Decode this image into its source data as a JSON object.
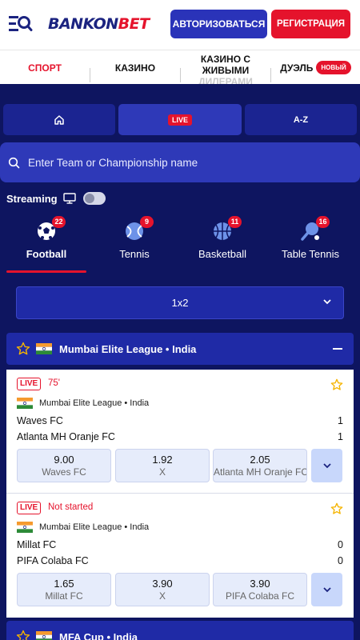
{
  "brand": {
    "logo_part1": "BANKON",
    "logo_part2": "BET"
  },
  "header": {
    "login_label": "АВТОРИЗОВАТЬСЯ",
    "register_label": "РЕГИСТРАЦИЯ"
  },
  "nav": {
    "items": [
      {
        "label": "СПОРТ"
      },
      {
        "label": "КАЗИНО"
      },
      {
        "label_line1": "КАЗИНО С",
        "label_line2": "ЖИВЫМИ",
        "label_line3": "ДИЛЕРАМИ"
      },
      {
        "label": "ДУЭЛЬ",
        "badge": "НОВЫЙ"
      }
    ]
  },
  "tabs": {
    "live": "LIVE",
    "az": "A-Z"
  },
  "search": {
    "placeholder": "Enter Team or Championship name"
  },
  "streaming": {
    "label": "Streaming",
    "enabled": false
  },
  "sports": [
    {
      "label": "Football",
      "count": "22",
      "icon": "football-icon",
      "active": true
    },
    {
      "label": "Tennis",
      "count": "9",
      "icon": "tennis-icon"
    },
    {
      "label": "Basketball",
      "count": "11",
      "icon": "basketball-icon"
    },
    {
      "label": "Table Tennis",
      "count": "16",
      "icon": "table-tennis-icon"
    }
  ],
  "market": {
    "selected": "1x2"
  },
  "leagues": [
    {
      "name": "Mumbai Elite League • India"
    },
    {
      "name": "MFA Cup • India"
    }
  ],
  "matches": [
    {
      "live": "LIVE",
      "status": "75'",
      "league": "Mumbai Elite League • India",
      "home": "Waves FC",
      "away": "Atlanta MH Oranje FC",
      "home_score": "1",
      "away_score": "1",
      "odds": [
        {
          "value": "9.00",
          "label": "Waves FC"
        },
        {
          "value": "1.92",
          "label": "X"
        },
        {
          "value": "2.05",
          "label": "Atlanta MH Oranje FC"
        }
      ]
    },
    {
      "live": "LIVE",
      "status": "Not started",
      "league": "Mumbai Elite League • India",
      "home": "Millat FC",
      "away": "PIFA Colaba FC",
      "home_score": "0",
      "away_score": "0",
      "odds": [
        {
          "value": "1.65",
          "label": "Millat FC"
        },
        {
          "value": "3.90",
          "label": "X"
        },
        {
          "value": "3.90",
          "label": "PIFA Colaba FC"
        }
      ]
    }
  ],
  "colors": {
    "brand_red": "#e5132c",
    "brand_blue": "#2a33b9",
    "page_bg": "#0e1560"
  }
}
